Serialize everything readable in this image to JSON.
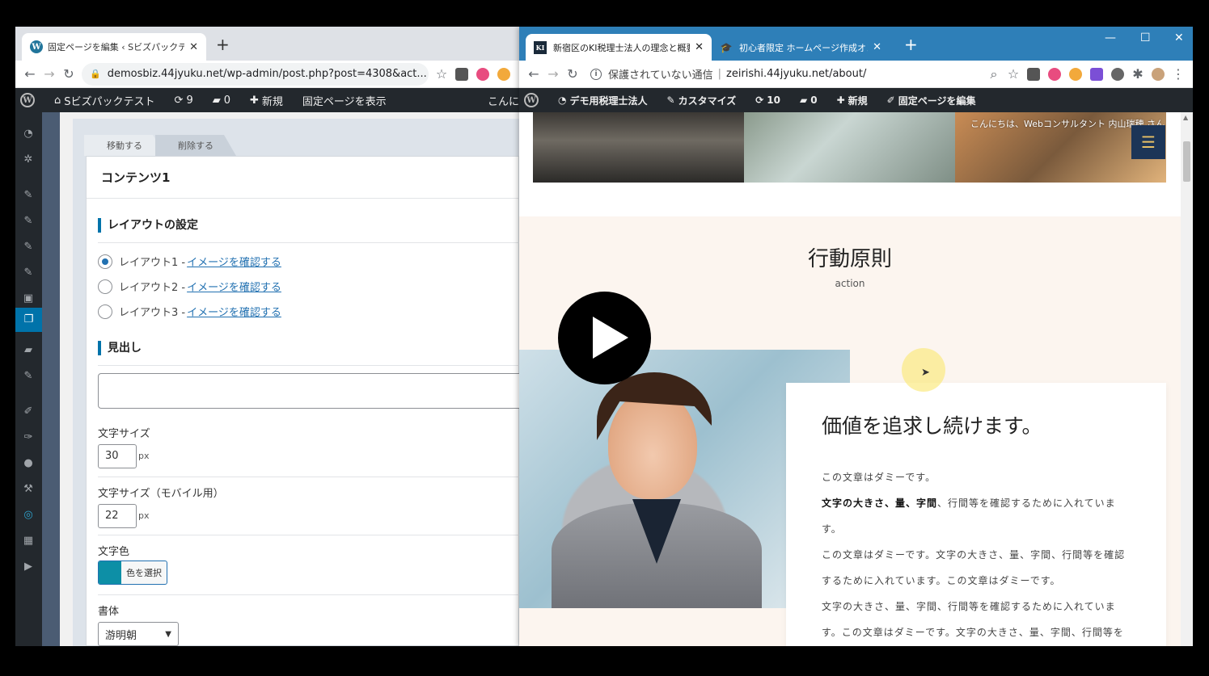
{
  "left": {
    "tab": {
      "title": "固定ページを編集 ‹ Sビズパックテスト",
      "close": "✕",
      "new": "+"
    },
    "omnibox": {
      "url": "demosbiz.44jyuku.net/wp-admin/post.php?post=4308&act..."
    },
    "adminbar": {
      "site": "Sビズパックテスト",
      "updates": "9",
      "comments": "0",
      "new": "新規",
      "view": "固定ページを表示",
      "greeting": "こんに"
    },
    "metabox": {
      "tabs": [
        "移動する",
        "削除する"
      ],
      "title": "コンテンツ1",
      "layout_heading": "レイアウトの設定",
      "layouts": [
        {
          "label": "レイアウト1 - ",
          "link": "イメージを確認する",
          "checked": true
        },
        {
          "label": "レイアウト2 - ",
          "link": "イメージを確認する",
          "checked": false
        },
        {
          "label": "レイアウト3 - ",
          "link": "イメージを確認する",
          "checked": false
        }
      ],
      "heading_label": "見出し",
      "heading_value": "",
      "font_size_label": "文字サイズ",
      "font_size_value": "30",
      "font_size_unit": "px",
      "font_size_mobile_label": "文字サイズ（モバイル用）",
      "font_size_mobile_value": "22",
      "font_size_mobile_unit": "px",
      "color_label": "文字色",
      "color_button": "色を選択",
      "color_value": "#0d8fa6",
      "font_label": "書体",
      "font_value": "游明朝"
    }
  },
  "right": {
    "tabs": [
      {
        "title": "新宿区のKI税理士法人の理念と概要",
        "favicon": "KI"
      },
      {
        "title": "初心者限定 ホームページ作成オンライン"
      }
    ],
    "omnibox": {
      "security": "保護されていない通信",
      "host": "zeirishi.44jyuku.net/about/"
    },
    "adminbar": {
      "site": "デモ用税理士法人",
      "customize": "カスタマイズ",
      "updates": "10",
      "comments": "0",
      "new": "新規",
      "edit": "固定ページを編集"
    },
    "greeting": "こんにちは、Webコンサルタント 内山瑞穂 さん",
    "section": {
      "heading": "行動原則",
      "subheading": "action",
      "card_heading": "価値を追求し続けます。",
      "p1": "この文章はダミーです。",
      "p2_bold": "文字の大きさ、量、字間",
      "p2_rest": "、行間等を確認するために入れていま",
      "p3": "す。",
      "p4": "この文章はダミーです。文字の大きさ、量、字間、行間等を確認",
      "p5": "するために入れています。この文章はダミーです。",
      "p6": "文字の大きさ、量、字間、行間等を確認するために入れていま",
      "p7": "す。この文章はダミーです。文字の大きさ、量、字間、行間等を"
    }
  }
}
